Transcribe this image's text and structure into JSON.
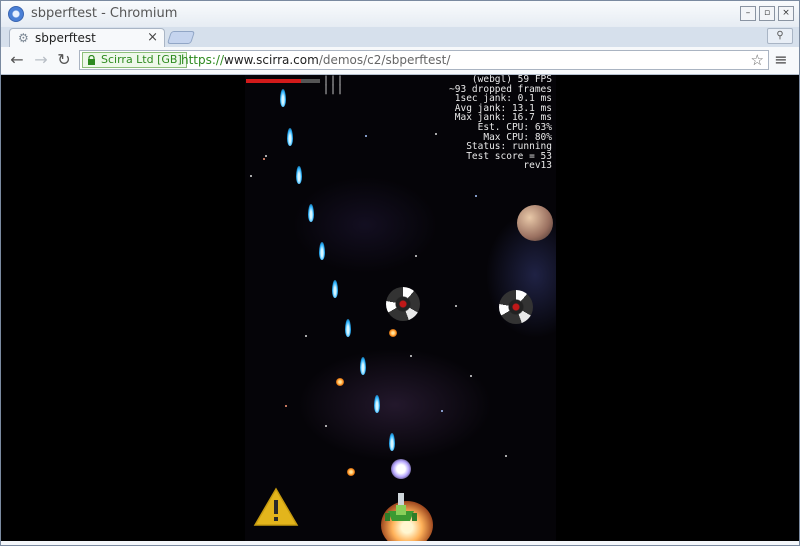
{
  "window": {
    "title": "sbperftest - Chromium",
    "minimize_label": "–",
    "restore_label": "▫",
    "close_label": "×"
  },
  "tab": {
    "title": "sbperftest",
    "close_label": "×"
  },
  "toolbar": {
    "back_label": "←",
    "forward_label": "→",
    "reload_label": "↻",
    "ev_label": "Scirra Ltd [GB]",
    "url_scheme": "https://",
    "url_host": "www.scirra.com",
    "url_path": "/demos/c2/sbperftest/",
    "star_label": "☆",
    "menu_label": "≡",
    "profile_label": "⚲"
  },
  "game": {
    "lives": "|||\n|||",
    "health_fraction": 0.74,
    "hud_lines": [
      "(webgl) 59 FPS",
      "~93 dropped frames",
      "1sec jank: 0.1 ms",
      "Avg jank: 13.1 ms",
      "Max jank: 16.7 ms",
      "Est. CPU: 63%",
      "Max CPU: 80%",
      "Status: running",
      "Test score = 53",
      "rev13"
    ]
  },
  "colors": {
    "ev_green": "#2d8a1e",
    "health_red": "#d11a1a",
    "bullet_blue": "#2ab3ff"
  }
}
